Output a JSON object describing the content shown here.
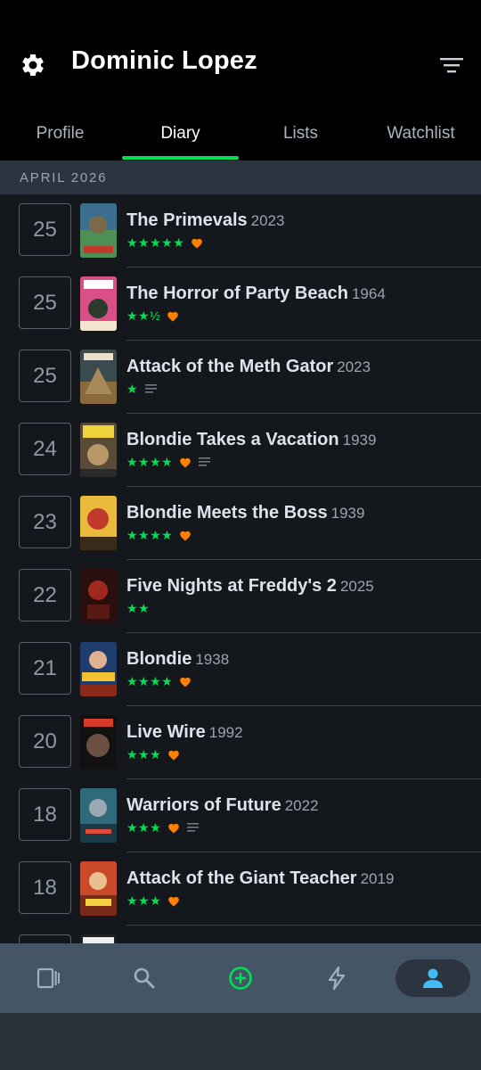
{
  "header": {
    "title": "Dominic Lopez",
    "settings_icon": "gear-icon",
    "filter_icon": "filter-icon"
  },
  "tabs": [
    {
      "label": "Profile",
      "active": false
    },
    {
      "label": "Diary",
      "active": true
    },
    {
      "label": "Lists",
      "active": false
    },
    {
      "label": "Watchlist",
      "active": false
    }
  ],
  "section": {
    "month": "APRIL 2026"
  },
  "entries": [
    {
      "day": "25",
      "title": "The Primevals",
      "year": "2023",
      "stars": "★★★★★",
      "liked": true,
      "review": false
    },
    {
      "day": "25",
      "title": "The Horror of Party Beach",
      "year": "1964",
      "stars": "★★½",
      "liked": true,
      "review": false
    },
    {
      "day": "25",
      "title": "Attack of the Meth Gator",
      "year": "2023",
      "stars": "★",
      "liked": false,
      "review": true
    },
    {
      "day": "24",
      "title": "Blondie Takes a Vacation",
      "year": "1939",
      "stars": "★★★★",
      "liked": true,
      "review": true
    },
    {
      "day": "23",
      "title": "Blondie Meets the Boss",
      "year": "1939",
      "stars": "★★★★",
      "liked": true,
      "review": false
    },
    {
      "day": "22",
      "title": "Five Nights at Freddy's 2",
      "year": "2025",
      "stars": "★★",
      "liked": false,
      "review": false
    },
    {
      "day": "21",
      "title": "Blondie",
      "year": "1938",
      "stars": "★★★★",
      "liked": true,
      "review": false
    },
    {
      "day": "20",
      "title": "Live Wire",
      "year": "1992",
      "stars": "★★★",
      "liked": true,
      "review": false
    },
    {
      "day": "18",
      "title": "Warriors of Future",
      "year": "2022",
      "stars": "★★★",
      "liked": true,
      "review": true
    },
    {
      "day": "18",
      "title": "Attack of the Giant Teacher",
      "year": "2019",
      "stars": "★★★",
      "liked": true,
      "review": false
    },
    {
      "day": "",
      "title": "",
      "year": "",
      "stars": "",
      "liked": false,
      "review": false
    }
  ],
  "bottom_nav": [
    {
      "name": "films-icon",
      "active": false
    },
    {
      "name": "search-icon",
      "active": false
    },
    {
      "name": "add-icon",
      "active": false
    },
    {
      "name": "activity-icon",
      "active": false
    },
    {
      "name": "profile-icon",
      "active": true
    }
  ],
  "colors": {
    "accent_green": "#00e054",
    "heart_orange": "#ff8000",
    "profile_blue": "#40bcf4",
    "background": "#14181c"
  }
}
